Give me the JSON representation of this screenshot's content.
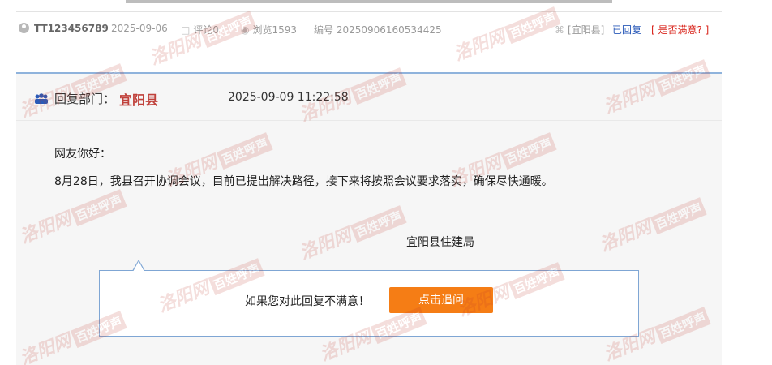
{
  "meta": {
    "user": "TT123456789",
    "date": "2025-09-06",
    "comments": "评论0",
    "views": "浏览1593",
    "code": "编号 20250906160534425",
    "department_tag": "[宜阳县]",
    "status": "已回复",
    "satisfaction_link": "[ 是否满意? ]"
  },
  "reply": {
    "dept_label": "回复部门：",
    "dept_name": "宜阳县",
    "time": "2025-09-09 11:22:58",
    "greeting": "网友你好：",
    "content": "8月28日，我县召开协调会议，目前已提出解决路径，接下来将按照会议要求落实，确保尽快通暖。",
    "signature": "宜阳县住建局"
  },
  "followup": {
    "prompt": "如果您对此回复不满意！",
    "button": "点击追问"
  },
  "watermark": {
    "script": "洛阳网",
    "stamp": "百姓呼声"
  },
  "colors": {
    "accent_orange": "#f57d15",
    "link_blue": "#2a5ab8",
    "alert_red": "#d9251c",
    "dept_red": "#c0413b",
    "border_blue": "#8fb3dc"
  }
}
